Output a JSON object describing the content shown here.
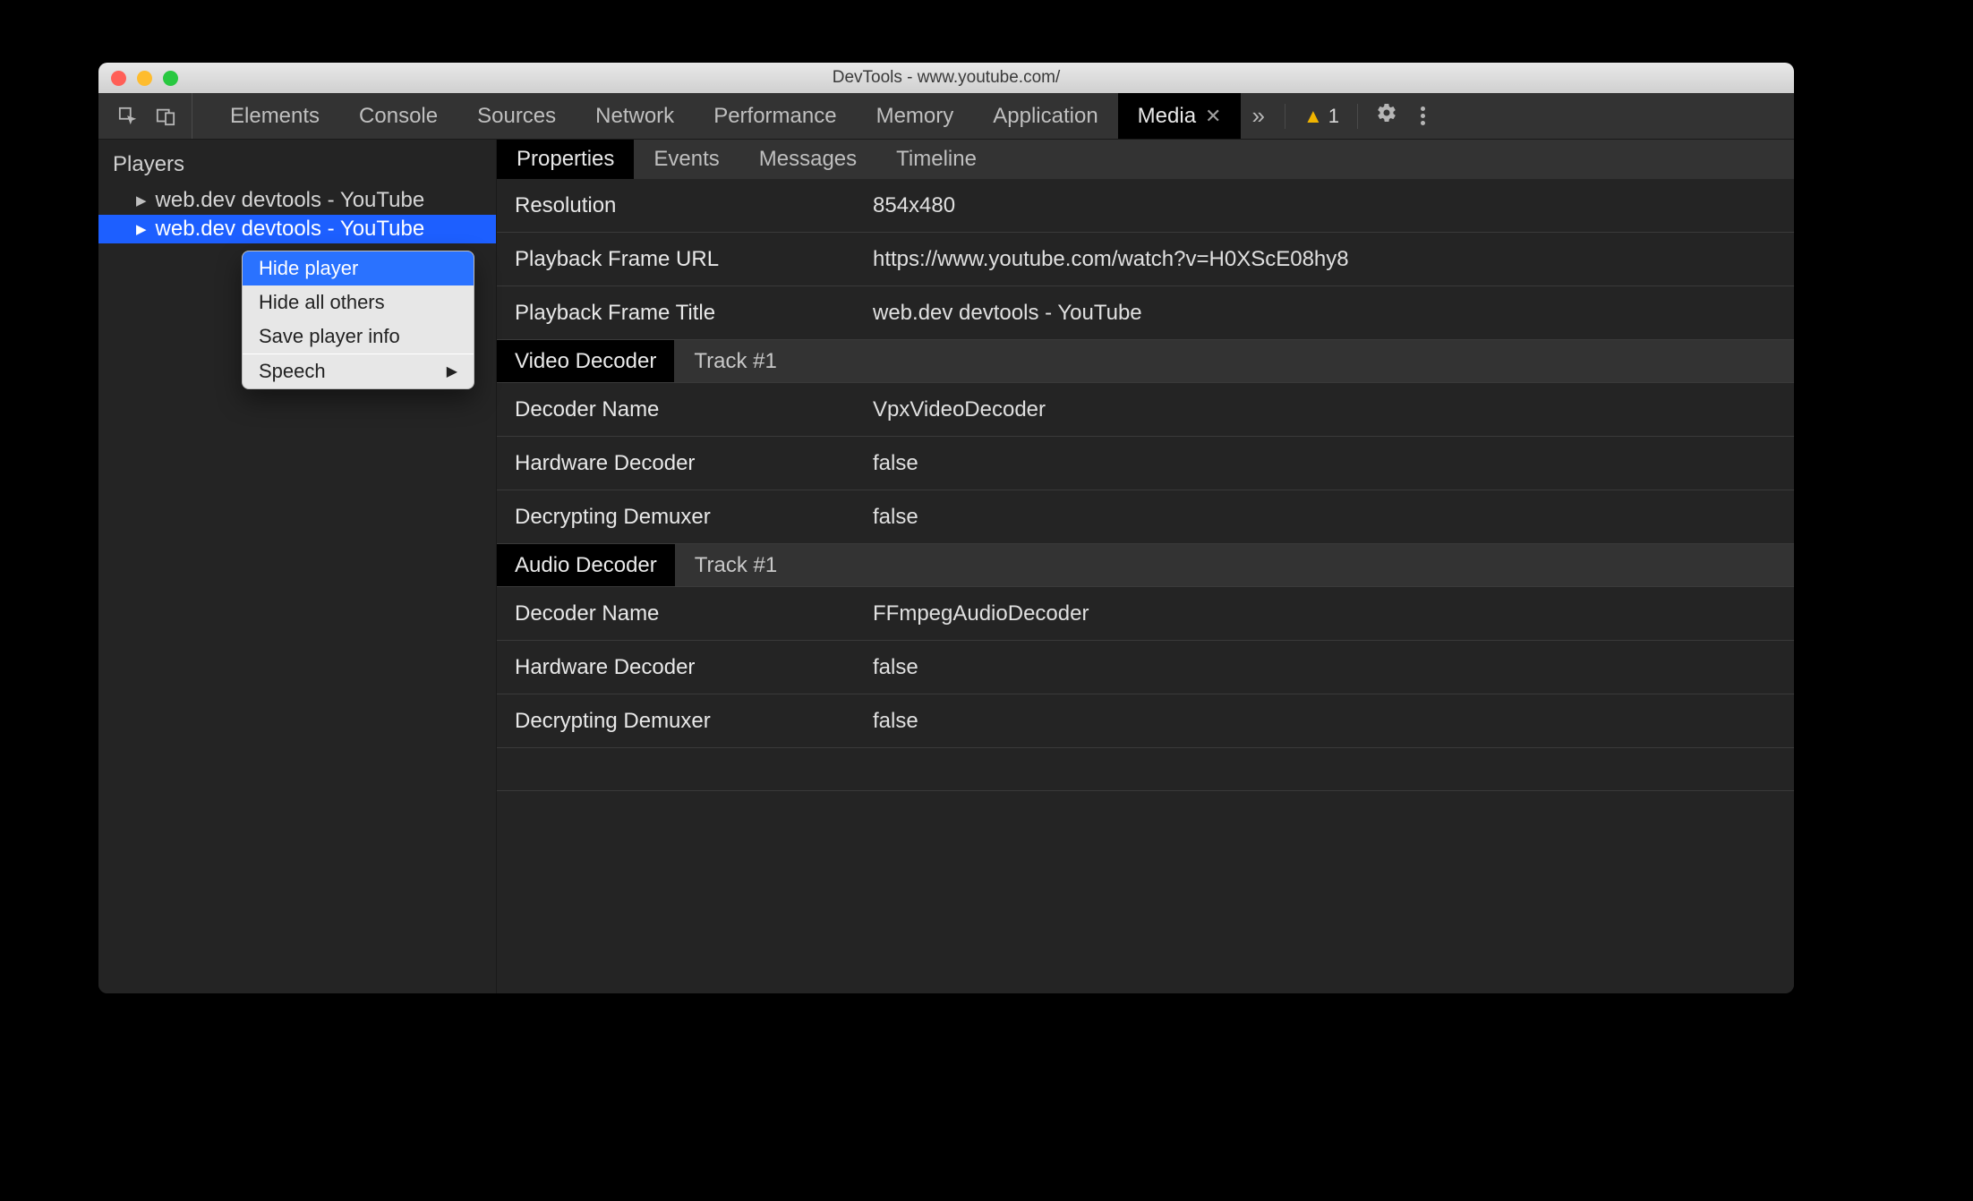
{
  "window": {
    "title": "DevTools - www.youtube.com/"
  },
  "tabs": {
    "items": [
      "Elements",
      "Console",
      "Sources",
      "Network",
      "Performance",
      "Memory",
      "Application",
      "Media"
    ],
    "active": "Media"
  },
  "warnings": {
    "count": "1"
  },
  "sidebar": {
    "header": "Players",
    "players": [
      {
        "label": "web.dev devtools - YouTube"
      },
      {
        "label": "web.dev devtools - YouTube"
      }
    ]
  },
  "contextMenu": {
    "items": [
      "Hide player",
      "Hide all others",
      "Save player info"
    ],
    "highlighted": "Hide player",
    "submenu": "Speech"
  },
  "subtabs": {
    "items": [
      "Properties",
      "Events",
      "Messages",
      "Timeline"
    ],
    "active": "Properties"
  },
  "properties": {
    "rows": [
      {
        "key": "Resolution",
        "value": "854x480"
      },
      {
        "key": "Playback Frame URL",
        "value": "https://www.youtube.com/watch?v=H0XScE08hy8"
      },
      {
        "key": "Playback Frame Title",
        "value": "web.dev devtools - YouTube"
      }
    ],
    "video": {
      "label": "Video Decoder",
      "track": "Track #1",
      "rows": [
        {
          "key": "Decoder Name",
          "value": "VpxVideoDecoder"
        },
        {
          "key": "Hardware Decoder",
          "value": "false"
        },
        {
          "key": "Decrypting Demuxer",
          "value": "false"
        }
      ]
    },
    "audio": {
      "label": "Audio Decoder",
      "track": "Track #1",
      "rows": [
        {
          "key": "Decoder Name",
          "value": "FFmpegAudioDecoder"
        },
        {
          "key": "Hardware Decoder",
          "value": "false"
        },
        {
          "key": "Decrypting Demuxer",
          "value": "false"
        }
      ]
    }
  }
}
